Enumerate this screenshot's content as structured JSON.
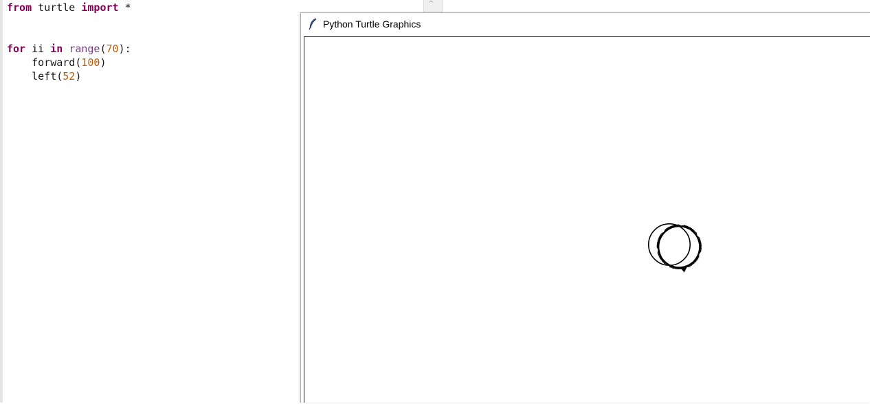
{
  "editor": {
    "lines": [
      [
        {
          "t": "from",
          "k": "kw"
        },
        {
          "t": " turtle ",
          "k": ""
        },
        {
          "t": "import",
          "k": "kw"
        },
        {
          "t": " *",
          "k": ""
        }
      ],
      [],
      [],
      [
        {
          "t": "for",
          "k": "kw"
        },
        {
          "t": " ii ",
          "k": ""
        },
        {
          "t": "in",
          "k": "kw"
        },
        {
          "t": " ",
          "k": ""
        },
        {
          "t": "range",
          "k": "builtin"
        },
        {
          "t": "(",
          "k": ""
        },
        {
          "t": "70",
          "k": "num"
        },
        {
          "t": "):",
          "k": ""
        }
      ],
      [
        {
          "t": "    forward(",
          "k": ""
        },
        {
          "t": "100",
          "k": "num"
        },
        {
          "t": ")",
          "k": ""
        }
      ],
      [
        {
          "t": "    left(",
          "k": ""
        },
        {
          "t": "52",
          "k": "num"
        },
        {
          "t": ")",
          "k": ""
        }
      ]
    ]
  },
  "turtle_window": {
    "title": "Python Turtle Graphics",
    "icon": "feather-icon"
  },
  "drawing": {
    "steps": 70,
    "forward": 100,
    "left_deg": 52,
    "pen_color": "#000000"
  },
  "colors": {
    "keyword": "#7f0055",
    "number": "#c35a00",
    "builtin": "#7a3b7f"
  }
}
